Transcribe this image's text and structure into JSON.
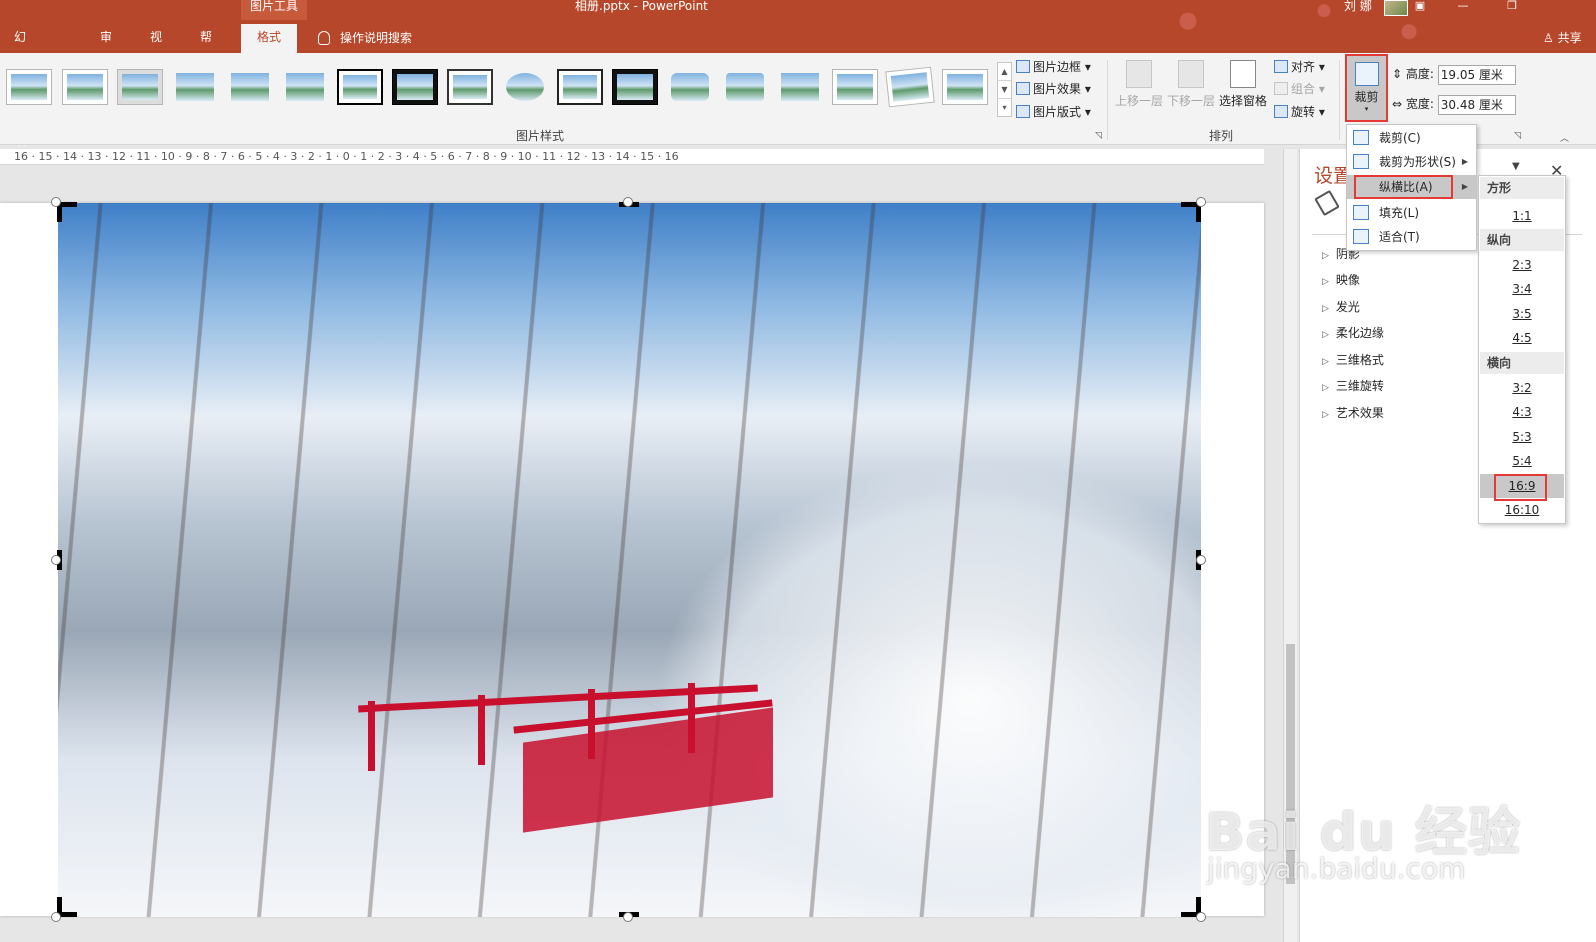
{
  "titlebar": {
    "context_tab": "图片工具",
    "doc_title": "相册.pptx  -  PowerPoint",
    "user": "刘 娜",
    "share": "共享"
  },
  "tabs": [
    "幻灯片放映",
    "审阅",
    "视图",
    "帮助",
    "格式"
  ],
  "tellme": "操作说明搜索",
  "ribbon": {
    "picture_border": "图片边框",
    "picture_effects": "图片效果",
    "picture_layout": "图片版式",
    "styles_group": "图片样式",
    "bring_forward": "上移一层",
    "send_backward": "下移一层",
    "selection_pane": "选择窗格",
    "align": "对齐",
    "group": "组合",
    "rotate": "旋转",
    "arrange_group": "排列",
    "crop": "裁剪",
    "height_label": "高度:",
    "height_value": "19.05 厘米",
    "width_label": "宽度:",
    "width_value": "30.48 厘米"
  },
  "ruler": "16 · 15 · 14 · 13 · 12 · 11 · 10 · 9 · 8 · 7 · 6 · 5 · 4 · 3 · 2 · 1 · 0 · 1 · 2 · 3 · 4 · 5 · 6 · 7 · 8 · 9 · 10 · 11 · 12 · 13 · 14 · 15 · 16",
  "pane": {
    "title": "设置",
    "items": [
      "阴影",
      "映像",
      "发光",
      "柔化边缘",
      "三维格式",
      "三维旋转",
      "艺术效果"
    ]
  },
  "crop_menu": {
    "items": [
      {
        "label": "裁剪(C)"
      },
      {
        "label": "裁剪为形状(S)"
      },
      {
        "label": "纵横比(A)"
      },
      {
        "label": "填充(L)"
      },
      {
        "label": "适合(T)"
      }
    ]
  },
  "aspect_menu": {
    "square": "方形",
    "portrait": "纵向",
    "landscape": "横向",
    "square_opts": [
      "1:1"
    ],
    "portrait_opts": [
      "2:3",
      "3:4",
      "3:5",
      "4:5"
    ],
    "landscape_opts": [
      "3:2",
      "4:3",
      "5:3",
      "5:4",
      "16:9",
      "16:10"
    ]
  },
  "watermark": {
    "brand": "Bai du 经验",
    "url": "jingyan.baidu.com"
  },
  "colors": {
    "accent": "#b7472a",
    "highlight_box": "#e53935",
    "bridge_red": "#c8102e"
  }
}
